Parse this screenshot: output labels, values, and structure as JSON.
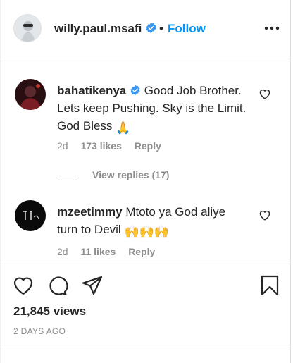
{
  "post": {
    "author": "willy.paul.msafi",
    "separator": "•",
    "follow_label": "Follow",
    "more_icon": "more-options-icon",
    "accent_color": "#0095f6"
  },
  "comments": [
    {
      "username": "bahatikenya",
      "verified": true,
      "text_line1": "Good Job Brother.",
      "text_line2": "Lets keep Pushing. Sky is the Limit.",
      "text_line3": "God Bless",
      "emoji": "🙏",
      "age": "2d",
      "likes": "173 likes",
      "reply_label": "Reply"
    },
    {
      "username": "mzeetimmy",
      "verified": false,
      "text_line1": "Mtoto ya God aliye",
      "text_line2": "turn to Devil",
      "emoji": "🙌🙌🙌",
      "age": "2d",
      "likes": "11 likes",
      "reply_label": "Reply"
    }
  ],
  "view_replies": "View replies (17)",
  "stats": {
    "views": "21,845 views",
    "posted": "2 DAYS AGO"
  }
}
